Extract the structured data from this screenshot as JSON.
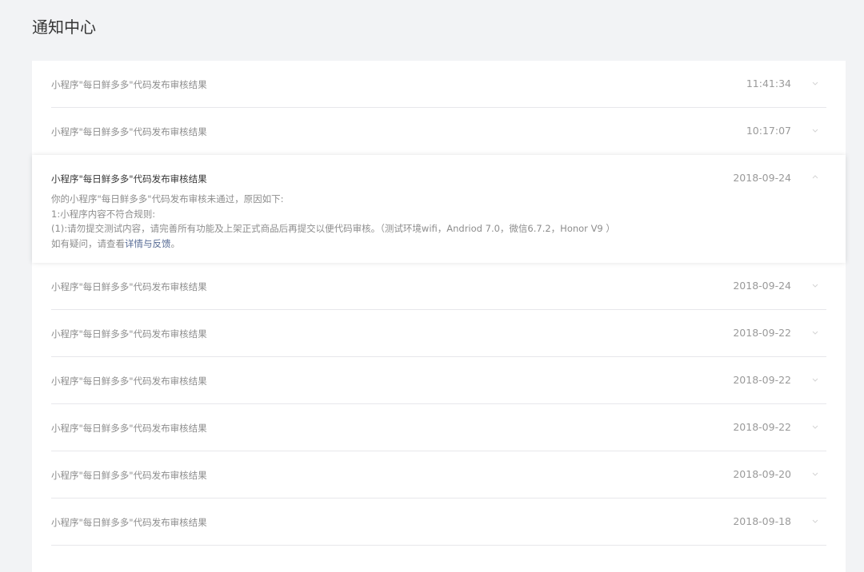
{
  "page": {
    "title": "通知中心"
  },
  "notifications": [
    {
      "title": "小程序\"每日鲜多多\"代码发布审核结果",
      "time": "11:41:34"
    },
    {
      "title": "小程序\"每日鲜多多\"代码发布审核结果",
      "time": "10:17:07"
    }
  ],
  "expanded": {
    "title": "小程序\"每日鲜多多\"代码发布审核结果",
    "time": "2018-09-24",
    "line1": "你的小程序\"每日鲜多多\"代码发布审核未通过，原因如下:",
    "line2": "1:小程序内容不符合规则:",
    "line3": "(1):请勿提交测试内容，请完善所有功能及上架正式商品后再提交以便代码审核。（测试环境wifi，Andriod 7.0，微信6.7.2，Honor V9 ）",
    "line4_prefix": "如有疑问，请查看",
    "line4_link": "详情与反馈",
    "line4_suffix": "。"
  },
  "more": [
    {
      "title": "小程序\"每日鲜多多\"代码发布审核结果",
      "time": "2018-09-24"
    },
    {
      "title": "小程序\"每日鲜多多\"代码发布审核结果",
      "time": "2018-09-22"
    },
    {
      "title": "小程序\"每日鲜多多\"代码发布审核结果",
      "time": "2018-09-22"
    },
    {
      "title": "小程序\"每日鲜多多\"代码发布审核结果",
      "time": "2018-09-22"
    },
    {
      "title": "小程序\"每日鲜多多\"代码发布审核结果",
      "time": "2018-09-20"
    },
    {
      "title": "小程序\"每日鲜多多\"代码发布审核结果",
      "time": "2018-09-18"
    }
  ],
  "colors": {
    "background": "#f2f3f5",
    "link": "#576b95",
    "divider": "#e7e7eb"
  },
  "icons": {
    "collapsed": "chevron-down-icon",
    "expanded": "chevron-up-icon"
  }
}
